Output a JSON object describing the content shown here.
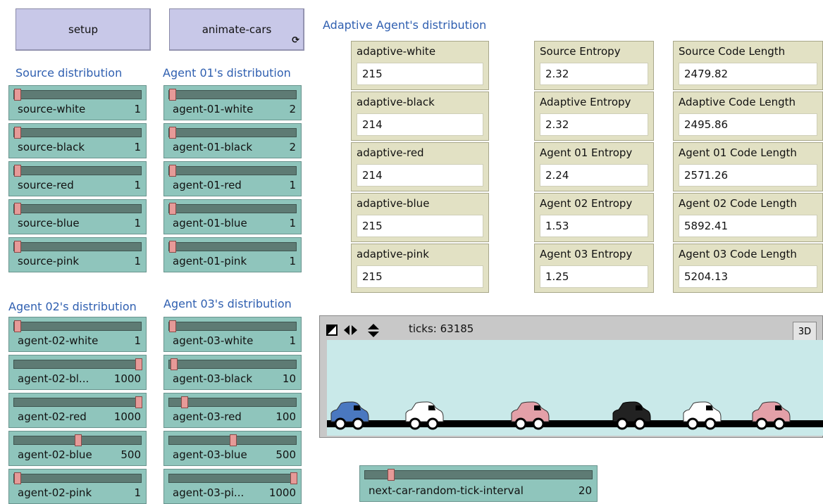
{
  "buttons": {
    "setup": "setup",
    "animate": "animate-cars"
  },
  "sections": {
    "source": "Source distribution",
    "agent01": "Agent 01's distribution",
    "agent02": "Agent 02's distribution",
    "agent03": "Agent 03's distribution",
    "adaptive": "Adaptive Agent's distribution"
  },
  "source_sliders": [
    {
      "label": "source-white",
      "value": "1",
      "pos": 0.0
    },
    {
      "label": "source-black",
      "value": "1",
      "pos": 0.0
    },
    {
      "label": "source-red",
      "value": "1",
      "pos": 0.0
    },
    {
      "label": "source-blue",
      "value": "1",
      "pos": 0.0
    },
    {
      "label": "source-pink",
      "value": "1",
      "pos": 0.0
    }
  ],
  "agent01_sliders": [
    {
      "label": "agent-01-white",
      "value": "2",
      "pos": 0.0
    },
    {
      "label": "agent-01-black",
      "value": "2",
      "pos": 0.0
    },
    {
      "label": "agent-01-red",
      "value": "1",
      "pos": 0.0
    },
    {
      "label": "agent-01-blue",
      "value": "1",
      "pos": 0.0
    },
    {
      "label": "agent-01-pink",
      "value": "1",
      "pos": 0.0
    }
  ],
  "agent02_sliders": [
    {
      "label": "agent-02-white",
      "value": "1",
      "pos": 0.0
    },
    {
      "label": "agent-02-bl...",
      "value": "1000",
      "pos": 1.0
    },
    {
      "label": "agent-02-red",
      "value": "1000",
      "pos": 1.0
    },
    {
      "label": "agent-02-blue",
      "value": "500",
      "pos": 0.5
    },
    {
      "label": "agent-02-pink",
      "value": "1",
      "pos": 0.0
    }
  ],
  "agent03_sliders": [
    {
      "label": "agent-03-white",
      "value": "1",
      "pos": 0.0
    },
    {
      "label": "agent-03-black",
      "value": "10",
      "pos": 0.01
    },
    {
      "label": "agent-03-red",
      "value": "100",
      "pos": 0.1
    },
    {
      "label": "agent-03-blue",
      "value": "500",
      "pos": 0.5
    },
    {
      "label": "agent-03-pi...",
      "value": "1000",
      "pos": 1.0
    }
  ],
  "adaptive_monitors": [
    {
      "label": "adaptive-white",
      "value": "215"
    },
    {
      "label": "adaptive-black",
      "value": "214"
    },
    {
      "label": "adaptive-red",
      "value": "214"
    },
    {
      "label": "adaptive-blue",
      "value": "215"
    },
    {
      "label": "adaptive-pink",
      "value": "215"
    }
  ],
  "entropy_monitors": [
    {
      "label": "Source Entropy",
      "value": "2.32"
    },
    {
      "label": "Adaptive Entropy",
      "value": "2.32"
    },
    {
      "label": "Agent 01 Entropy",
      "value": "2.24"
    },
    {
      "label": "Agent 02 Entropy",
      "value": "1.53"
    },
    {
      "label": "Agent 03 Entropy",
      "value": "1.25"
    }
  ],
  "codelen_monitors": [
    {
      "label": "Source Code Length",
      "value": "2479.82"
    },
    {
      "label": "Adaptive Code Length",
      "value": "2495.86"
    },
    {
      "label": "Agent 01 Code Length",
      "value": "2571.26"
    },
    {
      "label": "Agent 02 Code Length",
      "value": "5892.41"
    },
    {
      "label": "Agent 03 Code Length",
      "value": "5204.13"
    }
  ],
  "view": {
    "ticks": "ticks: 63185",
    "btn3d": "3D",
    "cars": [
      "blue",
      "white",
      "pink",
      "black",
      "white",
      "pink"
    ]
  },
  "interval_slider": {
    "label": "next-car-random-tick-interval",
    "value": "20",
    "pos": 0.05
  },
  "colors": {
    "blue": "#4a78c0",
    "white": "#ffffff",
    "pink": "#e3a0a8",
    "black": "#222222"
  }
}
